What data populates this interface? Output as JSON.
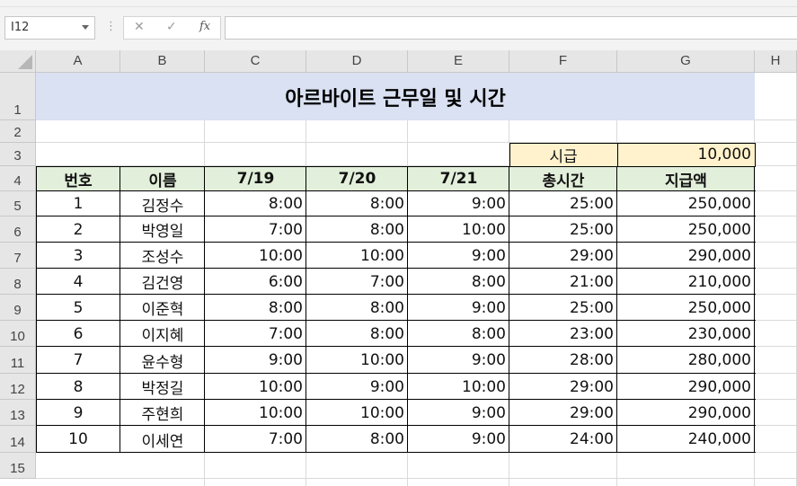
{
  "formula_bar": {
    "name_box": "I12",
    "cancel_glyph": "✕",
    "enter_glyph": "✓",
    "fx_glyph": "fx",
    "formula": ""
  },
  "columns": [
    "A",
    "B",
    "C",
    "D",
    "E",
    "F",
    "G",
    "H"
  ],
  "rows": [
    "1",
    "2",
    "3",
    "4",
    "5",
    "6",
    "7",
    "8",
    "9",
    "10",
    "11",
    "12",
    "13",
    "14",
    "15"
  ],
  "sheet": {
    "title": "아르바이트 근무일 및 시간",
    "wage_label": "시급",
    "wage_value": "10,000",
    "headers": [
      "번호",
      "이름",
      "7/19",
      "7/20",
      "7/21",
      "총시간",
      "지급액"
    ],
    "records": [
      [
        "1",
        "김정수",
        "8:00",
        "8:00",
        "9:00",
        "25:00",
        "250,000"
      ],
      [
        "2",
        "박영일",
        "7:00",
        "8:00",
        "10:00",
        "25:00",
        "250,000"
      ],
      [
        "3",
        "조성수",
        "10:00",
        "10:00",
        "9:00",
        "29:00",
        "290,000"
      ],
      [
        "4",
        "김건영",
        "6:00",
        "7:00",
        "8:00",
        "21:00",
        "210,000"
      ],
      [
        "5",
        "이준혁",
        "8:00",
        "8:00",
        "9:00",
        "25:00",
        "250,000"
      ],
      [
        "6",
        "이지혜",
        "7:00",
        "8:00",
        "8:00",
        "23:00",
        "230,000"
      ],
      [
        "7",
        "윤수형",
        "9:00",
        "10:00",
        "9:00",
        "28:00",
        "280,000"
      ],
      [
        "8",
        "박정길",
        "10:00",
        "9:00",
        "10:00",
        "29:00",
        "290,000"
      ],
      [
        "9",
        "주현희",
        "10:00",
        "10:00",
        "9:00",
        "29:00",
        "290,000"
      ],
      [
        "10",
        "이세연",
        "7:00",
        "8:00",
        "9:00",
        "24:00",
        "240,000"
      ]
    ]
  },
  "colors": {
    "title_fill": "#d9e1f2",
    "header_fill": "#e2efda",
    "wage_fill": "#fff2cc"
  }
}
